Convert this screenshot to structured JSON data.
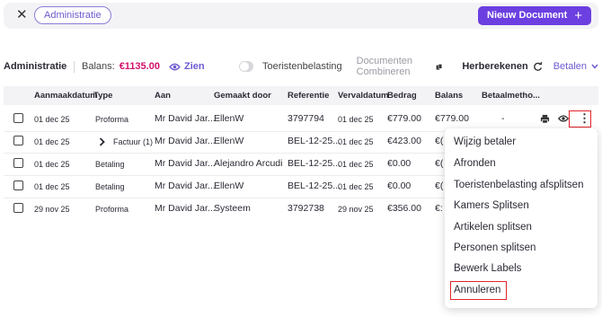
{
  "topbar": {
    "filter_chip": "Administratie",
    "new_document": "Nieuw Document"
  },
  "toolbar": {
    "title": "Administratie",
    "balance_label": "Balans:",
    "balance_value": "€1135.00",
    "zien": "Zien",
    "tourist_tax": "Toeristenbelasting",
    "combine": "Documenten Combineren",
    "recalculate": "Herberekenen",
    "payments": "Betalen"
  },
  "table": {
    "headers": [
      "Aanmaakdatum",
      "Type",
      "Aan",
      "Gemaakt door",
      "Referentie",
      "Vervaldatum",
      "Bedrag",
      "Balans",
      "Betaalmetho..."
    ],
    "rows": [
      {
        "date": "01 dec 25",
        "type": "Proforma",
        "to": "Mr David Jar...",
        "by": "EllenW",
        "ref": "3797794",
        "due": "01 dec 25",
        "amount": "€779.00",
        "balance": "€779.00",
        "method": "-"
      },
      {
        "date": "01 dec 25",
        "type": "Factuur (1)",
        "to": "Mr David Jar...",
        "by": "EllenW",
        "ref": "BEL-12-25...",
        "due": "01 dec 25",
        "amount": "€423.00",
        "balance": "€("
      },
      {
        "date": "01 dec 25",
        "type": "Betaling",
        "to": "Mr David Jar...",
        "by": "Alejandro Arcudi",
        "ref": "BEL-12-25...",
        "due": "01 dec 25",
        "amount": "€0.00",
        "balance": "€("
      },
      {
        "date": "01 dec 25",
        "type": "Betaling",
        "to": "Mr David Jar...",
        "by": "EllenW",
        "ref": "BEL-12-25...",
        "due": "01 dec 25",
        "amount": "€0.00",
        "balance": "€("
      },
      {
        "date": "29 nov 25",
        "type": "Proforma",
        "to": "Mr David Jar...",
        "by": "Systeem",
        "ref": "3792738",
        "due": "29 nov 25",
        "amount": "€356.00",
        "balance": "€:"
      }
    ]
  },
  "menu": {
    "items": [
      "Wijzig betaler",
      "Afronden",
      "Toeristenbelasting afsplitsen",
      "Kamers Splitsen",
      "Artikelen splitsen",
      "Personen splitsen",
      "Bewerk Labels",
      "Annuleren"
    ]
  },
  "colors": {
    "accent": "#6b3fe0",
    "balance": "#d2126a",
    "highlight": "#e0242b"
  }
}
